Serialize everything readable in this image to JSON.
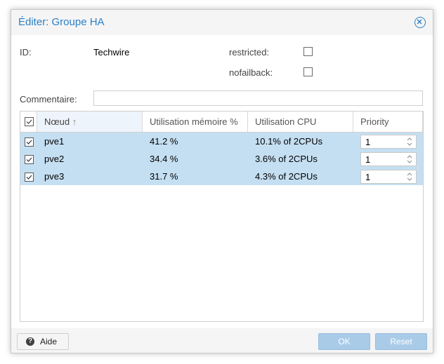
{
  "dialog": {
    "title": "Éditer: Groupe HA"
  },
  "form": {
    "id_label": "ID:",
    "id_value": "Techwire",
    "restricted_label": "restricted:",
    "restricted_checked": false,
    "nofailback_label": "nofailback:",
    "nofailback_checked": false,
    "comment_label": "Commentaire:",
    "comment_value": ""
  },
  "grid": {
    "columns": [
      "Nœud",
      "Utilisation mémoire %",
      "Utilisation CPU",
      "Priority"
    ],
    "sort_indicator": "↑",
    "rows": [
      {
        "selected": true,
        "node": "pve1",
        "memory": "41.2 %",
        "cpu": "10.1% of 2CPUs",
        "priority": "1"
      },
      {
        "selected": true,
        "node": "pve2",
        "memory": "34.4 %",
        "cpu": "3.6% of 2CPUs",
        "priority": "1"
      },
      {
        "selected": true,
        "node": "pve3",
        "memory": "31.7 %",
        "cpu": "4.3% of 2CPUs",
        "priority": "1"
      }
    ]
  },
  "footer": {
    "help_label": "Aide",
    "ok_label": "OK",
    "reset_label": "Reset"
  },
  "colors": {
    "accent": "#2a7fc6",
    "row_selected": "#c5dff2",
    "button_disabled": "#a9cbe8"
  }
}
